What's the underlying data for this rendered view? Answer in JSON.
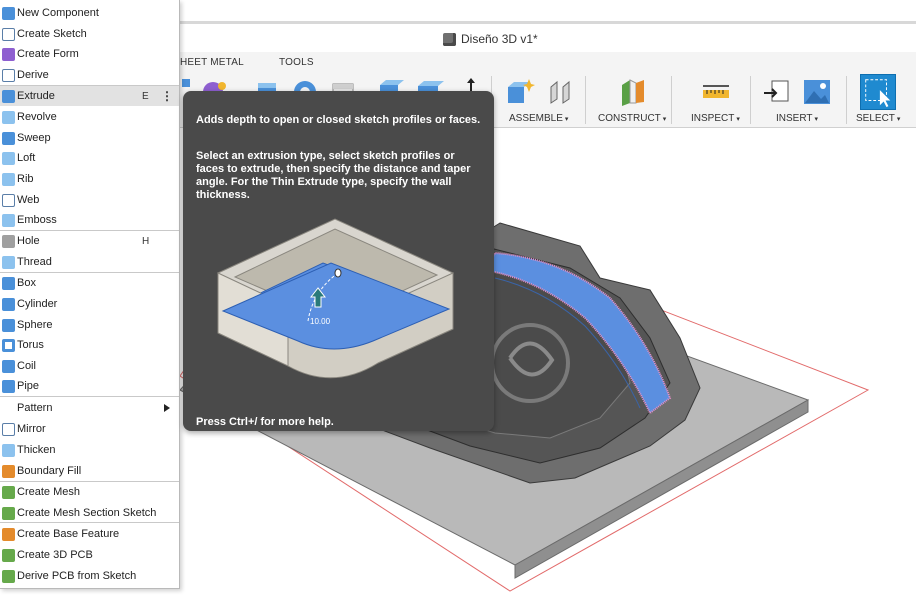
{
  "document": {
    "title": "Diseño 3D v1*"
  },
  "ribbon": {
    "tabs": [
      {
        "label": "HEET METAL"
      },
      {
        "label": "TOOLS"
      }
    ],
    "groups": {
      "assemble": "ASSEMBLE",
      "construct": "CONSTRUCT",
      "inspect": "INSPECT",
      "insert": "INSERT",
      "select": "SELECT"
    },
    "caret": "▾"
  },
  "menu": {
    "items": [
      {
        "label": "New Component",
        "icon": "new-component-icon"
      },
      {
        "label": "Create Sketch",
        "icon": "create-sketch-icon"
      },
      {
        "label": "Create Form",
        "icon": "create-form-icon"
      },
      {
        "label": "Derive",
        "icon": "derive-icon"
      },
      {
        "label": "Extrude",
        "icon": "extrude-icon",
        "shortcut": "E",
        "more": "⋮",
        "active": true
      },
      {
        "label": "Revolve",
        "icon": "revolve-icon"
      },
      {
        "label": "Sweep",
        "icon": "sweep-icon"
      },
      {
        "label": "Loft",
        "icon": "loft-icon"
      },
      {
        "label": "Rib",
        "icon": "rib-icon"
      },
      {
        "label": "Web",
        "icon": "web-icon"
      },
      {
        "label": "Emboss",
        "icon": "emboss-icon"
      },
      {
        "label": "Hole",
        "icon": "hole-icon",
        "shortcut": "H"
      },
      {
        "label": "Thread",
        "icon": "thread-icon"
      },
      {
        "label": "Box",
        "icon": "box-icon"
      },
      {
        "label": "Cylinder",
        "icon": "cylinder-icon"
      },
      {
        "label": "Sphere",
        "icon": "sphere-icon"
      },
      {
        "label": "Torus",
        "icon": "torus-icon"
      },
      {
        "label": "Coil",
        "icon": "coil-icon"
      },
      {
        "label": "Pipe",
        "icon": "pipe-icon"
      },
      {
        "label": "Pattern",
        "submenu": true
      },
      {
        "label": "Mirror",
        "icon": "mirror-icon"
      },
      {
        "label": "Thicken",
        "icon": "thicken-icon"
      },
      {
        "label": "Boundary Fill",
        "icon": "boundary-fill-icon"
      },
      {
        "label": "Create Mesh",
        "icon": "create-mesh-icon"
      },
      {
        "label": "Create Mesh Section Sketch",
        "icon": "mesh-section-sketch-icon"
      },
      {
        "label": "Create Base Feature",
        "icon": "base-feature-icon"
      },
      {
        "label": "Create 3D PCB",
        "icon": "pcb-3d-icon"
      },
      {
        "label": "Derive PCB from Sketch",
        "icon": "derive-pcb-icon"
      }
    ]
  },
  "tooltip": {
    "summary": "Adds depth to open or closed sketch profiles or faces.",
    "details": "Select an extrusion type, select sketch profiles or faces to extrude, then specify the distance and taper angle. For the Thin Extrude type, specify the wall thickness.",
    "dimension_label": "10.00",
    "footer": "Press Ctrl+/ for more help."
  },
  "colors": {
    "accent": "#1f8ad0",
    "tooltip_bg": "#4a4a4a",
    "extrude_face": "#5b8fe0"
  }
}
